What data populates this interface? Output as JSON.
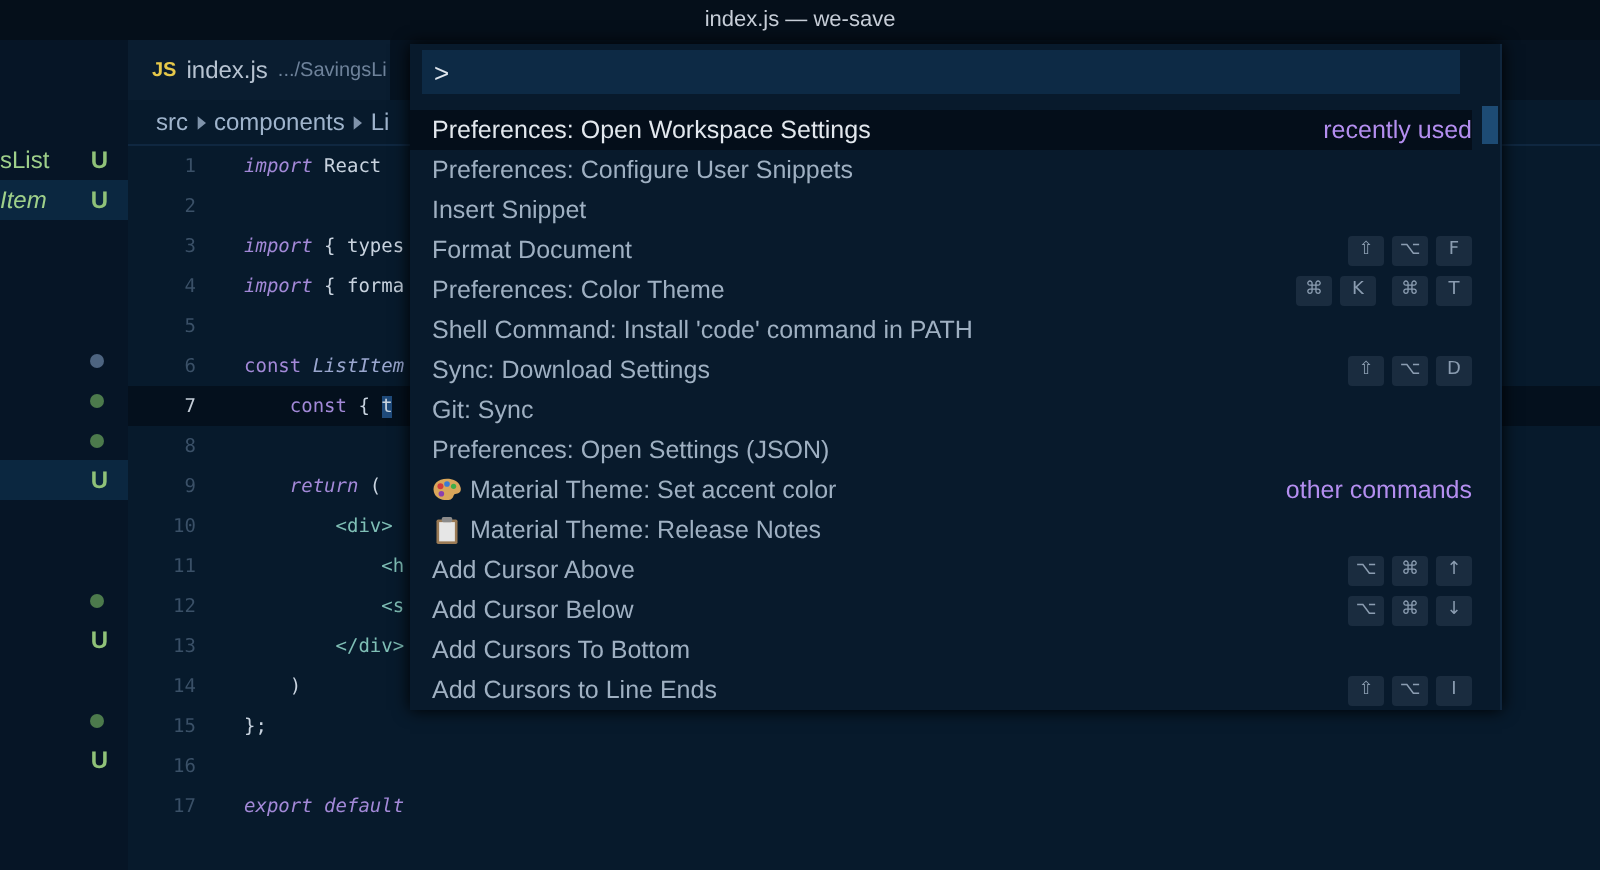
{
  "window": {
    "title": "index.js — we-save"
  },
  "sidebar": {
    "items": [
      {
        "kind": "file",
        "label": "sList",
        "badge": "U",
        "italic": false,
        "selected": false
      },
      {
        "kind": "file",
        "label": "Item",
        "badge": "U",
        "italic": true,
        "selected": true
      },
      {
        "kind": "blank"
      },
      {
        "kind": "blank"
      },
      {
        "kind": "blank"
      },
      {
        "kind": "dot",
        "color": "#4d6480"
      },
      {
        "kind": "dot",
        "color": "#4c7a4c"
      },
      {
        "kind": "dot",
        "color": "#4c7a4c"
      },
      {
        "kind": "file",
        "badge": "U",
        "selected": true
      },
      {
        "kind": "blank"
      },
      {
        "kind": "blank"
      },
      {
        "kind": "dot",
        "color": "#4c7a4c"
      },
      {
        "kind": "file",
        "badge": "U",
        "selected": false
      },
      {
        "kind": "blank"
      },
      {
        "kind": "dot",
        "color": "#4c7a4c"
      },
      {
        "kind": "file",
        "badge": "U",
        "selected": false
      }
    ]
  },
  "tab": {
    "icon_text": "JS",
    "name": "index.js",
    "path": ".../SavingsLi"
  },
  "breadcrumb": [
    "src",
    "components",
    "Li"
  ],
  "code": [
    {
      "number": "1",
      "current": false,
      "tokens": [
        {
          "kind": "keyword",
          "text": "import"
        },
        {
          "kind": "plain",
          "text": " React"
        }
      ]
    },
    {
      "number": "2",
      "current": false
    },
    {
      "number": "3",
      "current": false,
      "tokens": [
        {
          "kind": "keyword",
          "text": "import"
        },
        {
          "kind": "plain",
          "text": " { types"
        }
      ]
    },
    {
      "number": "4",
      "current": false,
      "tokens": [
        {
          "kind": "keyword",
          "text": "import"
        },
        {
          "kind": "plain",
          "text": " { forma"
        }
      ]
    },
    {
      "number": "5",
      "current": false
    },
    {
      "number": "6",
      "current": false,
      "tokens": [
        {
          "kind": "storage",
          "text": "const "
        },
        {
          "kind": "name",
          "text": "ListItem"
        }
      ]
    },
    {
      "number": "7",
      "current": true,
      "tokens": [
        {
          "kind": "storage",
          "text": "    const "
        },
        {
          "kind": "plain",
          "text": "{ "
        },
        {
          "kind": "selection",
          "text": "t"
        }
      ]
    },
    {
      "number": "8",
      "current": false
    },
    {
      "number": "9",
      "current": false,
      "tokens": [
        {
          "kind": "keyword",
          "text": "    return"
        },
        {
          "kind": "plain",
          "text": " ("
        }
      ]
    },
    {
      "number": "10",
      "current": false,
      "tokens": [
        {
          "kind": "tag",
          "text": "        <div>"
        }
      ]
    },
    {
      "number": "11",
      "current": false,
      "tokens": [
        {
          "kind": "tag",
          "text": "            <h"
        }
      ]
    },
    {
      "number": "12",
      "current": false,
      "tokens": [
        {
          "kind": "tag",
          "text": "            <s"
        }
      ]
    },
    {
      "number": "13",
      "current": false,
      "tokens": [
        {
          "kind": "tag",
          "text": "        </div>"
        }
      ]
    },
    {
      "number": "14",
      "current": false,
      "tokens": [
        {
          "kind": "plain",
          "text": "    )"
        }
      ]
    },
    {
      "number": "15",
      "current": false,
      "tokens": [
        {
          "kind": "plain",
          "text": "};"
        }
      ]
    },
    {
      "number": "16",
      "current": false
    },
    {
      "number": "17",
      "current": false,
      "tokens": [
        {
          "kind": "keyword",
          "text": "export default"
        }
      ]
    }
  ],
  "palette": {
    "input_value": ">",
    "items": [
      {
        "label": "Preferences: Open Workspace Settings",
        "selected": true,
        "group": "recently used"
      },
      {
        "label": "Preferences: Configure User Snippets",
        "selected": false
      },
      {
        "label": "Insert Snippet",
        "selected": false
      },
      {
        "label": "Format Document",
        "selected": false,
        "keys": [
          [
            "⇧",
            "⌥",
            "F"
          ]
        ]
      },
      {
        "label": "Preferences: Color Theme",
        "selected": false,
        "keys": [
          [
            "⌘",
            "K"
          ],
          [
            "⌘",
            "T"
          ]
        ]
      },
      {
        "label": "Shell Command: Install 'code' command in PATH",
        "selected": false
      },
      {
        "label": "Sync: Download Settings",
        "selected": false,
        "keys": [
          [
            "⇧",
            "⌥",
            "D"
          ]
        ]
      },
      {
        "label": "Git: Sync",
        "selected": false
      },
      {
        "label": "Preferences: Open Settings (JSON)",
        "selected": false
      },
      {
        "label": "Material Theme: Set accent color",
        "selected": false,
        "kind": "palette",
        "group": "other commands"
      },
      {
        "label": "Material Theme: Release Notes",
        "selected": false,
        "kind": "clipboard"
      },
      {
        "label": "Add Cursor Above",
        "selected": false,
        "keys": [
          [
            "⌥",
            "⌘",
            "↑"
          ]
        ]
      },
      {
        "label": "Add Cursor Below",
        "selected": false,
        "keys": [
          [
            "⌥",
            "⌘",
            "↓"
          ]
        ]
      },
      {
        "label": "Add Cursors To Bottom",
        "selected": false
      },
      {
        "label": "Add Cursors to Line Ends",
        "selected": false,
        "keys": [
          [
            "⇧",
            "⌥",
            "I"
          ]
        ]
      }
    ]
  }
}
